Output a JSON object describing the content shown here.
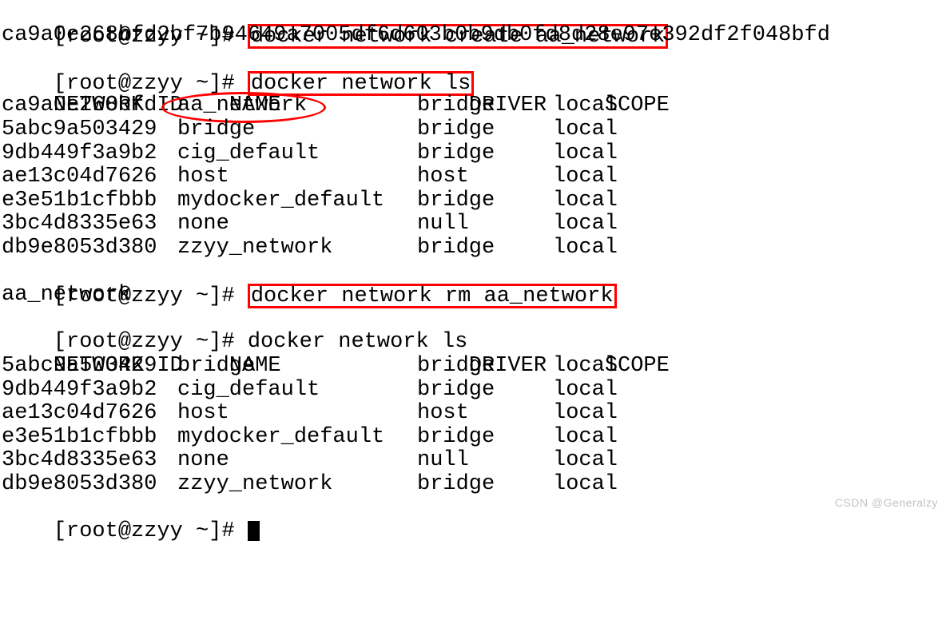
{
  "p1": "[root@zzyy ~]#",
  "cmd1": "docker network create aa_network",
  "out1": "ca9a0e268bfd2bf7b94649a7005df6d603b0b9db0fd8d28e97e392df2f048bfd",
  "cmd2": "docker network ls",
  "h_id": "NETWORK ID",
  "h_name": "NAME",
  "h_drv": "DRIVER",
  "h_scp": "SCOPE",
  "list1": [
    {
      "id": "ca9a0e268bfd",
      "name": "aa_network",
      "drv": "bridge",
      "scp": "local",
      "hl": true
    },
    {
      "id": "5abc9a503429",
      "name": "bridge",
      "drv": "bridge",
      "scp": "local"
    },
    {
      "id": "9db449f3a9b2",
      "name": "cig_default",
      "drv": "bridge",
      "scp": "local"
    },
    {
      "id": "ae13c04d7626",
      "name": "host",
      "drv": "host",
      "scp": "local"
    },
    {
      "id": "e3e51b1cfbbb",
      "name": "mydocker_default",
      "drv": "bridge",
      "scp": "local"
    },
    {
      "id": "3bc4d8335e63",
      "name": "none",
      "drv": "null",
      "scp": "local"
    },
    {
      "id": "db9e8053d380",
      "name": "zzyy_network",
      "drv": "bridge",
      "scp": "local"
    }
  ],
  "cmd3": "docker network rm aa_network",
  "out3": "aa_network",
  "cmd4": "docker network ls",
  "list2": [
    {
      "id": "5abc9a503429",
      "name": "bridge",
      "drv": "bridge",
      "scp": "local"
    },
    {
      "id": "9db449f3a9b2",
      "name": "cig_default",
      "drv": "bridge",
      "scp": "local"
    },
    {
      "id": "ae13c04d7626",
      "name": "host",
      "drv": "host",
      "scp": "local"
    },
    {
      "id": "e3e51b1cfbbb",
      "name": "mydocker_default",
      "drv": "bridge",
      "scp": "local"
    },
    {
      "id": "3bc4d8335e63",
      "name": "none",
      "drv": "null",
      "scp": "local"
    },
    {
      "id": "db9e8053d380",
      "name": "zzyy_network",
      "drv": "bridge",
      "scp": "local"
    }
  ],
  "watermark": "CSDN @Generalzy"
}
